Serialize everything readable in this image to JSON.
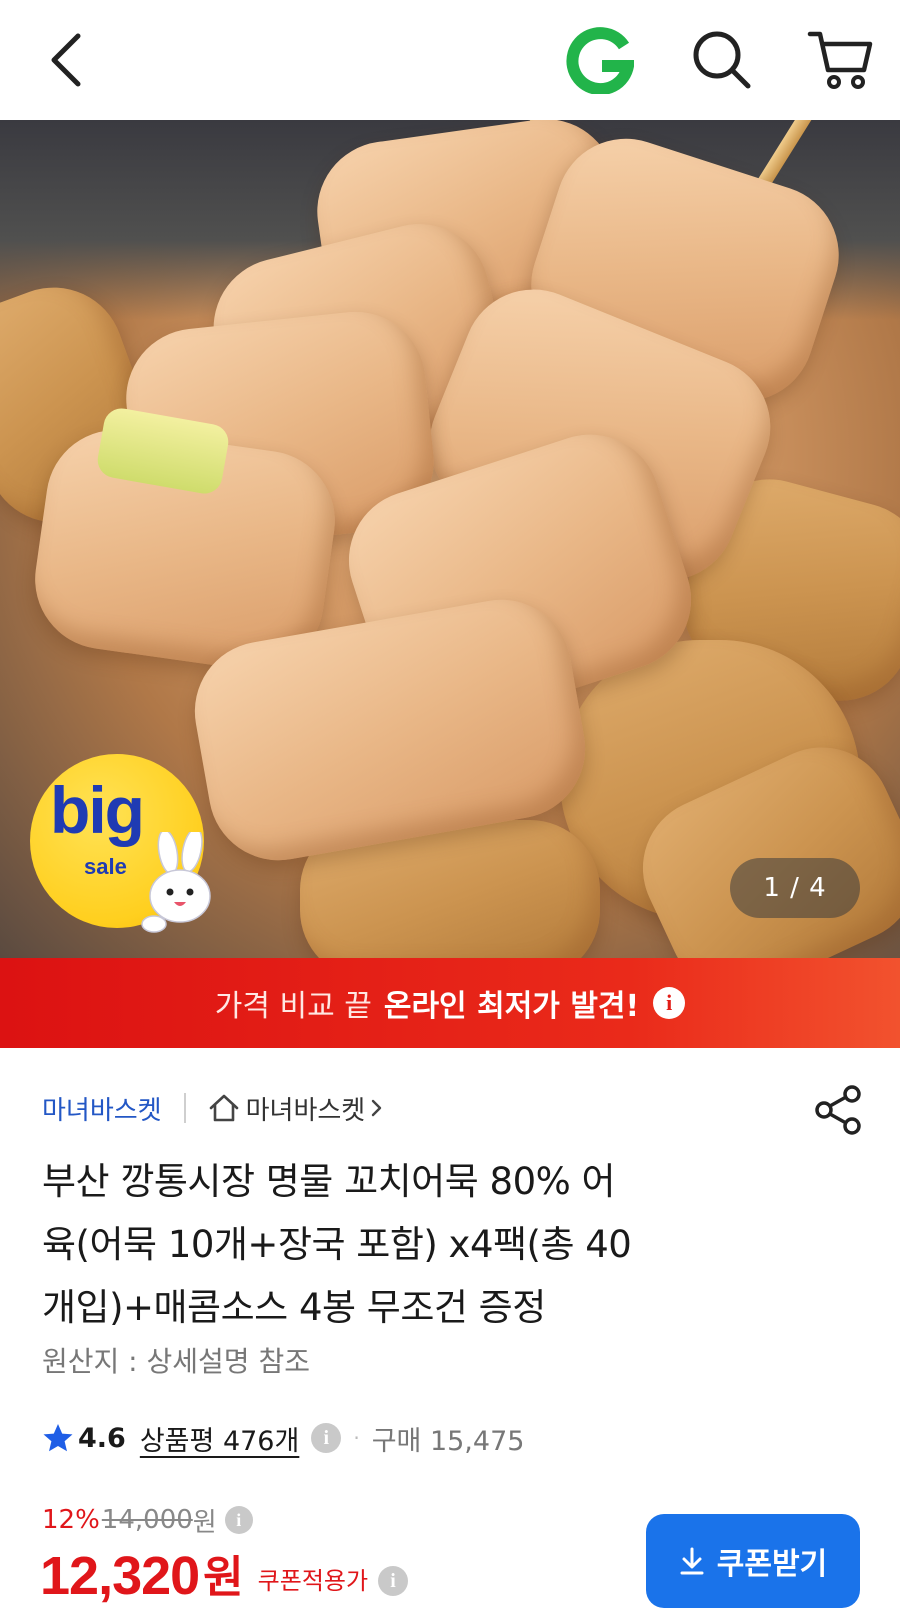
{
  "header": {
    "back_icon": "chevron-left-icon",
    "logo": "G",
    "logo_color": "#22b44a",
    "search_icon": "search-icon",
    "cart_icon": "cart-icon"
  },
  "hero": {
    "image_subject": "fish cake skewers",
    "pager": "1 / 4",
    "badge": {
      "big": "big",
      "sale": "sale"
    }
  },
  "banner": {
    "normal": "가격 비교 끝",
    "strong": "온라인 최저가 발견!",
    "info_icon": "i",
    "color": "#e21c17"
  },
  "seller": {
    "name": "마녀바스켓",
    "shop_link": "마녀바스켓",
    "share_icon": "share-icon"
  },
  "product": {
    "title_lines": [
      "부산 깡통시장 명물 꼬치어묵 80% 어",
      "육(어묵 10개+장국 포함) x4팩(총 40",
      "개입)+매콤소스 4봉 무조건 증정"
    ],
    "origin": "원산지 : 상세설명 참조"
  },
  "rating": {
    "value": "4.6",
    "review_label": "상품평 476개",
    "purchase": "구매 15,475",
    "star_color": "#1f5ee6"
  },
  "price": {
    "discount_rate": "12%",
    "original": "14,000",
    "original_unit": "원",
    "final": "12,320",
    "final_unit": "원",
    "coupon_applied_label": "쿠폰적용가",
    "accent": "#e0161a"
  },
  "coupon_button": {
    "label": "쿠폰받기",
    "color": "#1a73ea"
  }
}
